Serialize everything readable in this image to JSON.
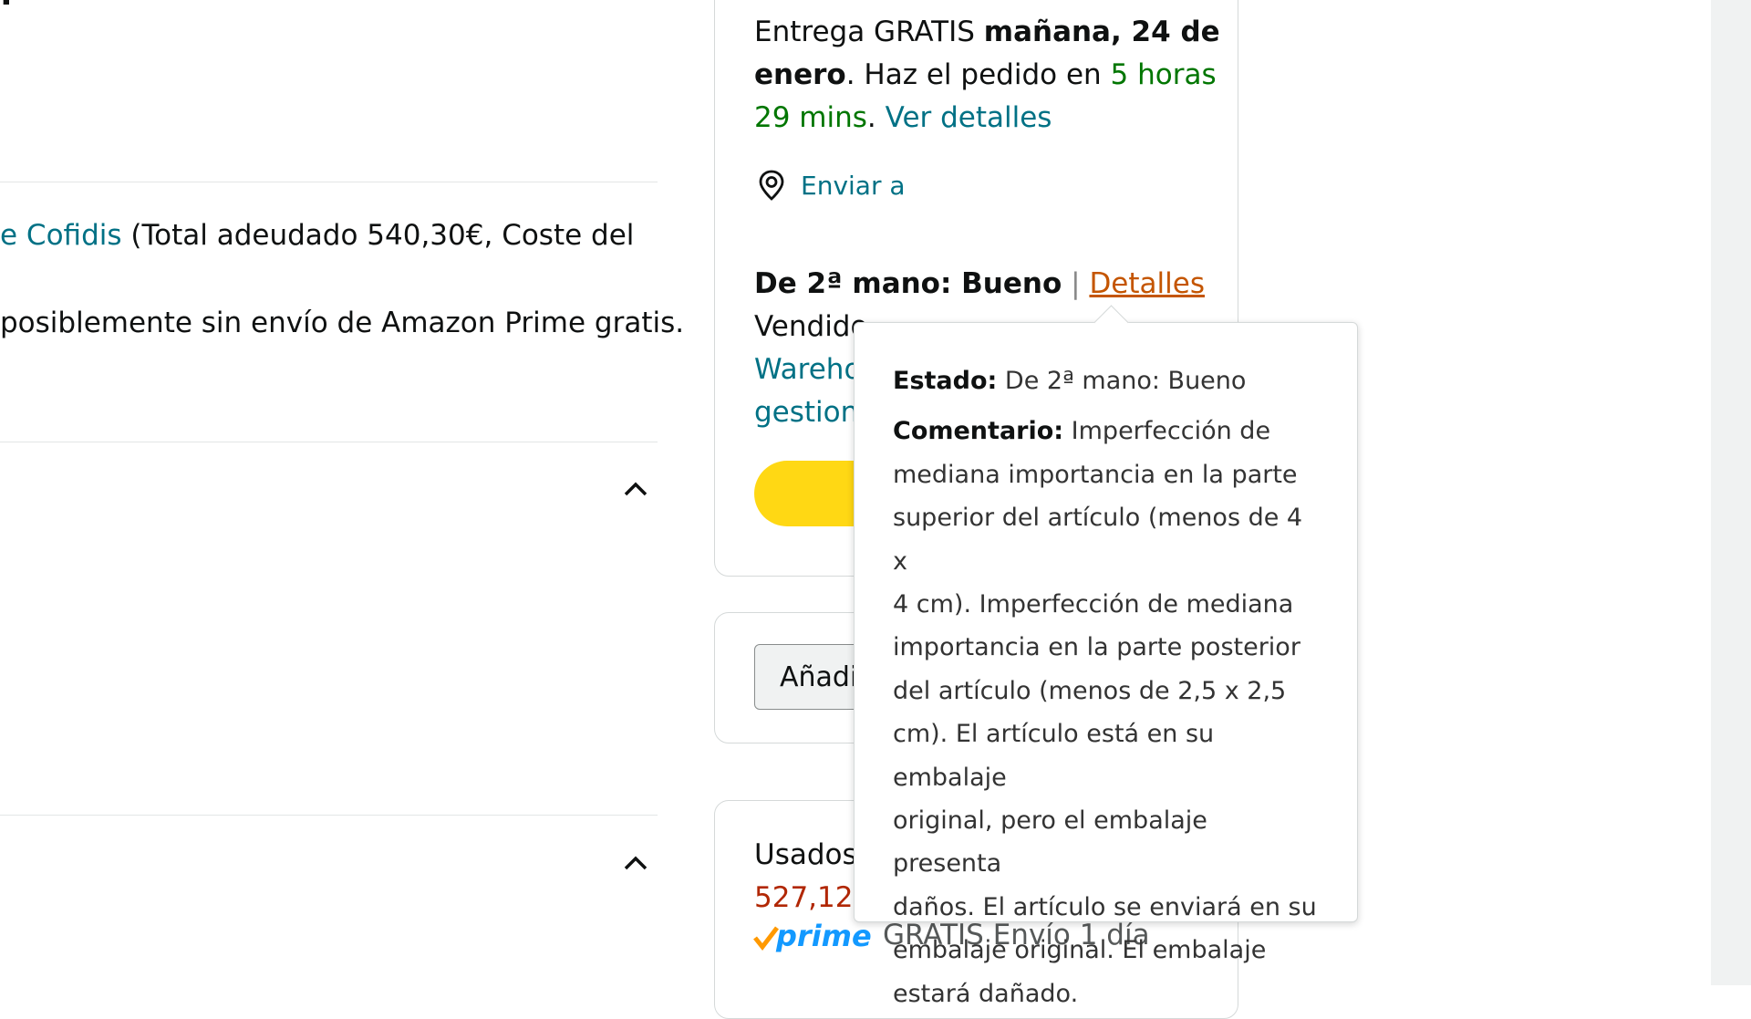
{
  "left": {
    "cofidis_link": "e Cofidis",
    "cofidis_rest": "(Total adeudado 540,30€, Coste del",
    "prime_note": "posiblemente sin envío de Amazon Prime gratis."
  },
  "delivery": {
    "prefix": "Entrega GRATIS ",
    "date_bold_1": "mañana, 24 de",
    "date_bold_2": "enero",
    "mid": ". Haz el pedido en ",
    "countdown_1": "5 horas",
    "countdown_2": "29 mins",
    "dot": ".",
    "details_link": "Ver detalles",
    "ship_to": "Enviar a"
  },
  "condition": {
    "label": "De 2ª mano: Bueno",
    "separator": "|",
    "details_link": "Detalles",
    "sold_by_partial": "Vendido",
    "warehouse_partial": "Wareho",
    "managed_partial": "gestion"
  },
  "add_button_partial": "Añadi",
  "used": {
    "label_partial": "Usados",
    "price_partial": "527,12",
    "prime": "prime",
    "shipping": "GRATIS Envío 1 día"
  },
  "popover": {
    "state_label": "Estado:",
    "state_value": "De 2ª mano: Bueno",
    "comment_label": "Comentario:",
    "comment_lines": [
      "Imperfección de",
      "mediana importancia en la parte",
      "superior del artículo (menos de 4 x",
      "4 cm). Imperfección de mediana",
      "importancia en la parte posterior",
      "del artículo (menos de 2,5 x 2,5",
      "cm). El artículo está en su embalaje",
      "original, pero el embalaje presenta",
      "daños. El artículo se enviará en su",
      "embalaje original. El embalaje",
      "estará dañado."
    ]
  },
  "colors": {
    "link": "#007185",
    "green": "#007600",
    "price": "#b12704",
    "buy_button": "#ffd814",
    "prime_check": "#ff9900",
    "prime_text": "#1399ff"
  }
}
